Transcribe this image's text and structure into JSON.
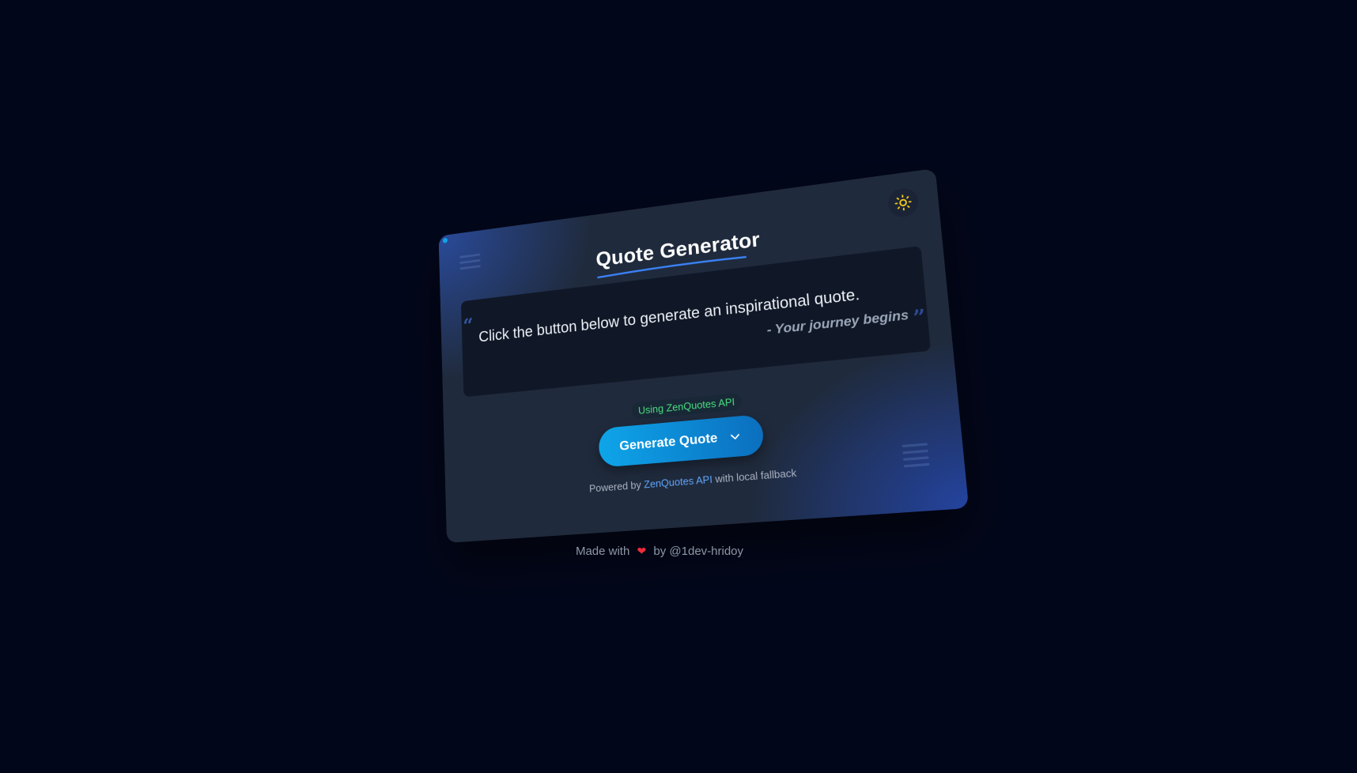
{
  "app": {
    "title": "Quote Generator"
  },
  "theme_toggle": {
    "icon": "sun-icon",
    "color": "#facc15"
  },
  "quote": {
    "text": "Click the button below to generate an inspirational quote.",
    "author": "- Your journey begins"
  },
  "api_status": {
    "label": "Using ZenQuotes API",
    "color": "#4ade80"
  },
  "generate_button": {
    "label": "Generate Quote",
    "icon": "chevron-down-icon"
  },
  "powered_by": {
    "prefix": "Powered by",
    "link_text": "ZenQuotes API",
    "suffix": "with local fallback"
  },
  "footer": {
    "prefix": "Made with",
    "heart": "❤",
    "suffix": "by @1dev-hridoy"
  },
  "colors": {
    "background": "#02061a",
    "card": "#1f2a3c",
    "accent": "#0ea5e9",
    "link": "#60a5fa"
  }
}
